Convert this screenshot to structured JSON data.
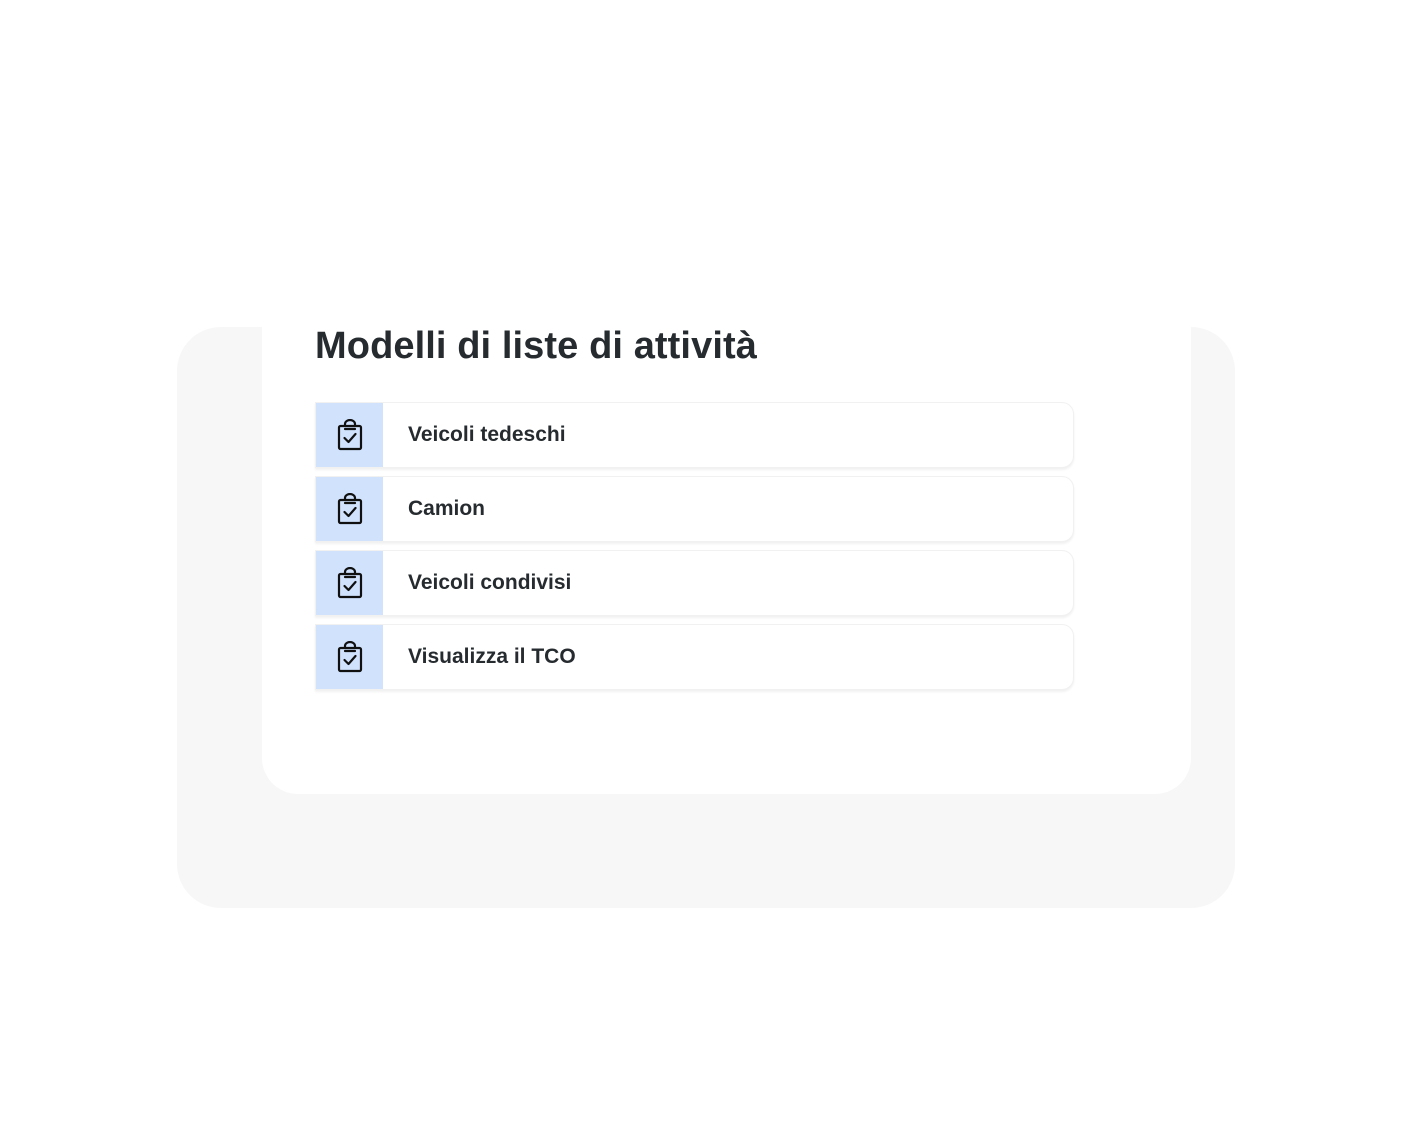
{
  "page": {
    "title": "Modelli di liste di attività"
  },
  "templates": [
    {
      "label": "Veicoli tedeschi",
      "icon": "clipboard-check-icon"
    },
    {
      "label": "Camion",
      "icon": "clipboard-check-icon"
    },
    {
      "label": "Veicoli condivisi",
      "icon": "clipboard-check-icon"
    },
    {
      "label": "Visualizza il TCO",
      "icon": "clipboard-check-icon"
    }
  ],
  "colors": {
    "icon_background": "#d1e2fd",
    "backdrop": "#f7f7f7",
    "text": "#262b2f"
  }
}
